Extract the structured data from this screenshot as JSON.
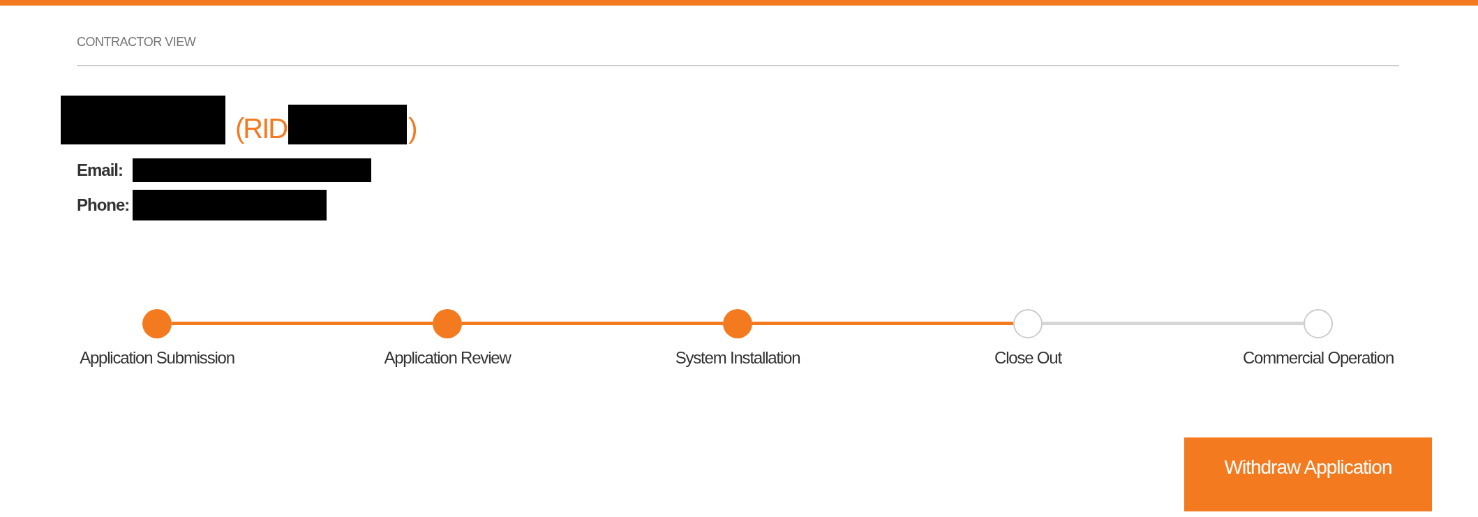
{
  "header": {
    "title": "CONTRACTOR VIEW"
  },
  "applicant": {
    "name_redacted": true,
    "rid_prefix": "(RID",
    "rid_redacted": true,
    "rid_suffix": ")"
  },
  "contact": [
    {
      "label": "Email:",
      "redacted": true
    },
    {
      "label": "Phone:",
      "redacted": true
    }
  ],
  "steps": [
    {
      "label": "Application Submission",
      "completed": true
    },
    {
      "label": "Application Review",
      "completed": true
    },
    {
      "label": "System Installation",
      "completed": true
    },
    {
      "label": "Close Out",
      "completed": false
    },
    {
      "label": "Commercial Operation",
      "completed": false
    }
  ],
  "actions": [
    {
      "label": "Withdraw Application"
    }
  ]
}
